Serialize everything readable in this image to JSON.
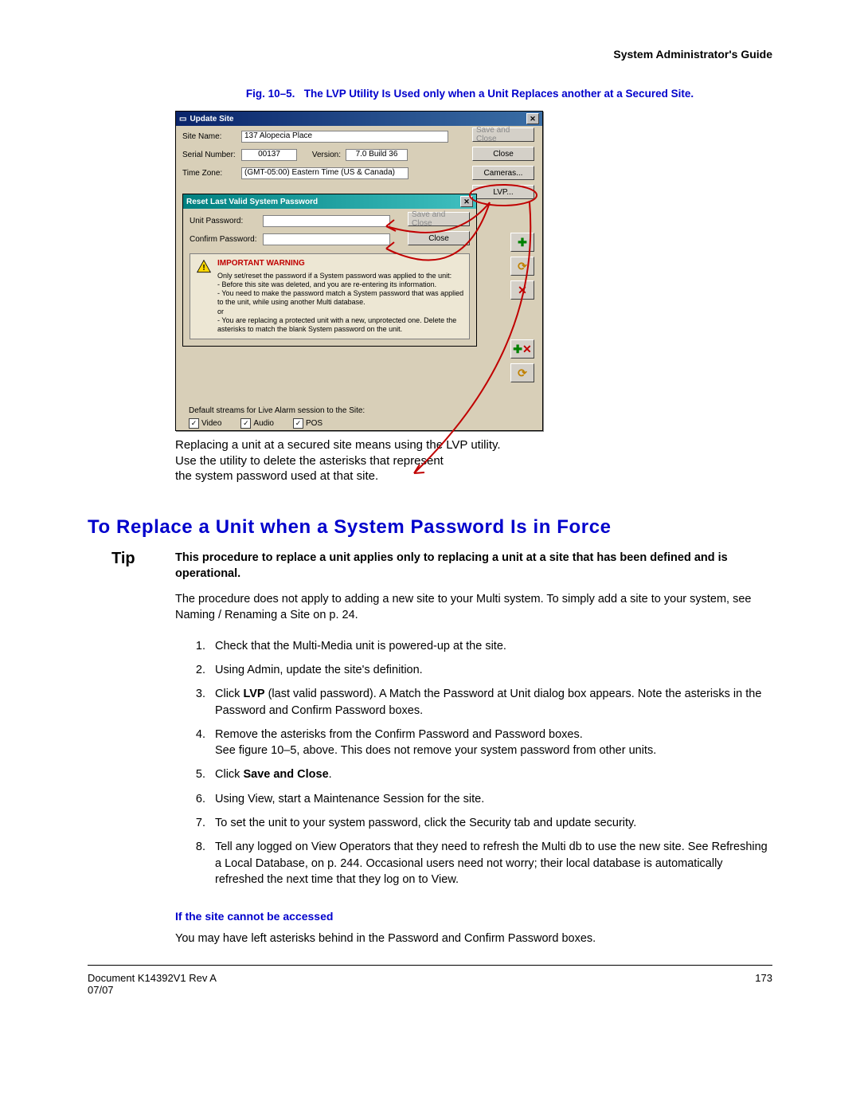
{
  "header": {
    "title": "System Administrator's Guide"
  },
  "figure": {
    "caption_prefix": "Fig. 10–5.",
    "caption_text": "The LVP Utility Is Used only when a Unit Replaces another at a Secured Site."
  },
  "dialog1": {
    "title": "Update Site",
    "labels": {
      "site_name": "Site Name:",
      "serial": "Serial Number:",
      "version": "Version:",
      "tz": "Time Zone:"
    },
    "values": {
      "site_name": "137 Alopecia Place",
      "serial": "00137",
      "version": "7.0 Build 36",
      "tz": "(GMT-05:00) Eastern Time (US & Canada)"
    },
    "buttons": {
      "save_close": "Save and Close",
      "close": "Close",
      "cameras": "Cameras...",
      "lvp": "LVP..."
    },
    "bottom_label": "Default streams for Live Alarm session to the Site:",
    "cb": {
      "video": "Video",
      "audio": "Audio",
      "pos": "POS"
    }
  },
  "dialog2": {
    "title": "Reset Last Valid System Password",
    "labels": {
      "unit_pw": "Unit Password:",
      "confirm_pw": "Confirm Password:"
    },
    "buttons": {
      "save_close": "Save and Close",
      "close": "Close"
    },
    "warning": {
      "title": "IMPORTANT WARNING",
      "body1": "Only set/reset the password if a System password was applied to the unit:",
      "body2": "- Before this site was deleted, and you are re-entering its information.",
      "body3": "- You need to make the password match a System password that was applied to the unit, while using another Multi database.",
      "body4": "or",
      "body5": "- You are replacing a protected unit with a new, unprotected one. Delete the asterisks to match the blank System password on the unit."
    }
  },
  "caption_body": {
    "l1": "Replacing a unit at a secured site means using the LVP utility.",
    "l2": "Use the utility to delete the asterisks that represent",
    "l3": "the system password used at that site."
  },
  "section": {
    "heading": "To Replace a Unit when a System Password Is in Force",
    "tip_label": "Tip",
    "tip_bold": "This procedure to replace a unit applies only to replacing a unit at a site that has been defined and is operational.",
    "tip_body": "The procedure does not apply to adding a new site to your Multi system. To simply add a site to your system, see Naming / Renaming a Site on p. 24.",
    "steps": [
      "Check that the Multi-Media unit is powered-up at the site.",
      "Using Admin, update the site's definition.",
      {
        "pre": "Click ",
        "bold": "LVP",
        "post": " (last valid password). A Match the Password at Unit dialog box appears. Note the asterisks in the Password and Confirm Password boxes."
      },
      {
        "line1": "Remove the asterisks from the Confirm Password and  Password boxes.",
        "line2": "See figure 10–5, above. This does not remove your system password from other units."
      },
      {
        "pre": "Click ",
        "bold": "Save and Close",
        "post": "."
      },
      "Using View, start a Maintenance Session for the site.",
      "To set the unit to your system password, click the Security tab and update security.",
      "Tell any logged on View Operators that they need to refresh the Multi db to use the new site. See Refreshing a Local Database, on p. 244. Occasional users need not worry; their local database is automatically refreshed the next time that they log on to View."
    ],
    "subhead": "If the site cannot be accessed",
    "subbody": "You may have left asterisks behind in the Password and Confirm Password boxes."
  },
  "footer": {
    "left1": "Document K14392V1 Rev A",
    "left2": "07/07",
    "page": "173"
  }
}
